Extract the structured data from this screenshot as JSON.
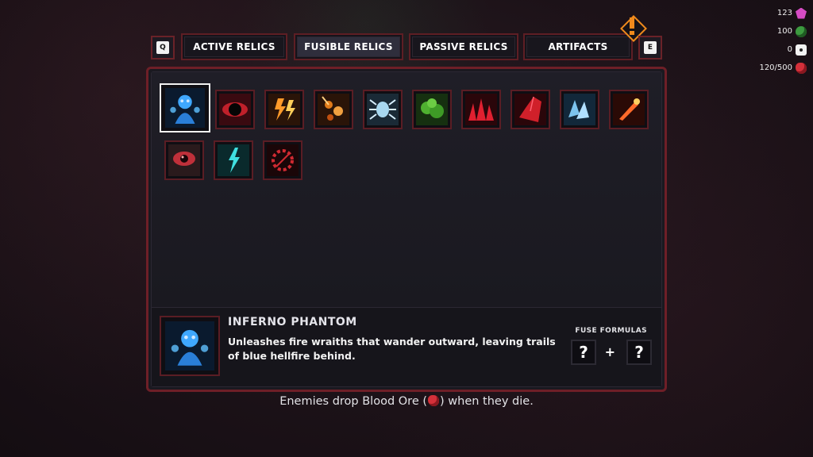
{
  "resources": [
    {
      "value": "123",
      "icon": "pink-crystal-icon"
    },
    {
      "value": "100",
      "icon": "green-orb-icon"
    },
    {
      "value": "0",
      "icon": "dice-icon"
    },
    {
      "value": "120/500",
      "icon": "blood-ore-icon"
    }
  ],
  "tabs": {
    "prev_key": "Q",
    "next_key": "E",
    "items": [
      {
        "label": "ACTIVE RELICS"
      },
      {
        "label": "FUSIBLE RELICS"
      },
      {
        "label": "PASSIVE RELICS"
      },
      {
        "label": "ARTIFACTS"
      }
    ],
    "active": "FUSIBLE RELICS"
  },
  "relics": [
    {
      "name": "inferno-phantom",
      "color": "#3fa8ff"
    },
    {
      "name": "black-hole",
      "color": "#c0202a"
    },
    {
      "name": "lightning-flame",
      "color": "#ff9a2a"
    },
    {
      "name": "meteor-rain",
      "color": "#e07a1a"
    },
    {
      "name": "frost-spider",
      "color": "#a8d8f0"
    },
    {
      "name": "toxic-cloud",
      "color": "#4fb030"
    },
    {
      "name": "blood-spikes",
      "color": "#e02030"
    },
    {
      "name": "crimson-cloak",
      "color": "#d0202a"
    },
    {
      "name": "ice-shards",
      "color": "#7cc4ee"
    },
    {
      "name": "fire-dagger",
      "color": "#ff6a2a"
    },
    {
      "name": "blood-eye",
      "color": "#c0303a"
    },
    {
      "name": "cyan-lightning",
      "color": "#40e0e0"
    },
    {
      "name": "blood-ring",
      "color": "#d02a32"
    }
  ],
  "detail": {
    "name": "INFERNO PHANTOM",
    "description": "Unleashes fire wraiths that wander outward, leaving trails of blue hellfire behind.",
    "fuse_label": "FUSE FORMULAS",
    "slot_a": "?",
    "slot_b": "?",
    "plus": "+"
  },
  "tip": {
    "before": "Enemies drop Blood Ore (",
    "after": ") when they die."
  },
  "colors": {
    "accent": "#6e1f27",
    "alert": "#f08a1c",
    "selected_border": "#f2f2f2"
  }
}
